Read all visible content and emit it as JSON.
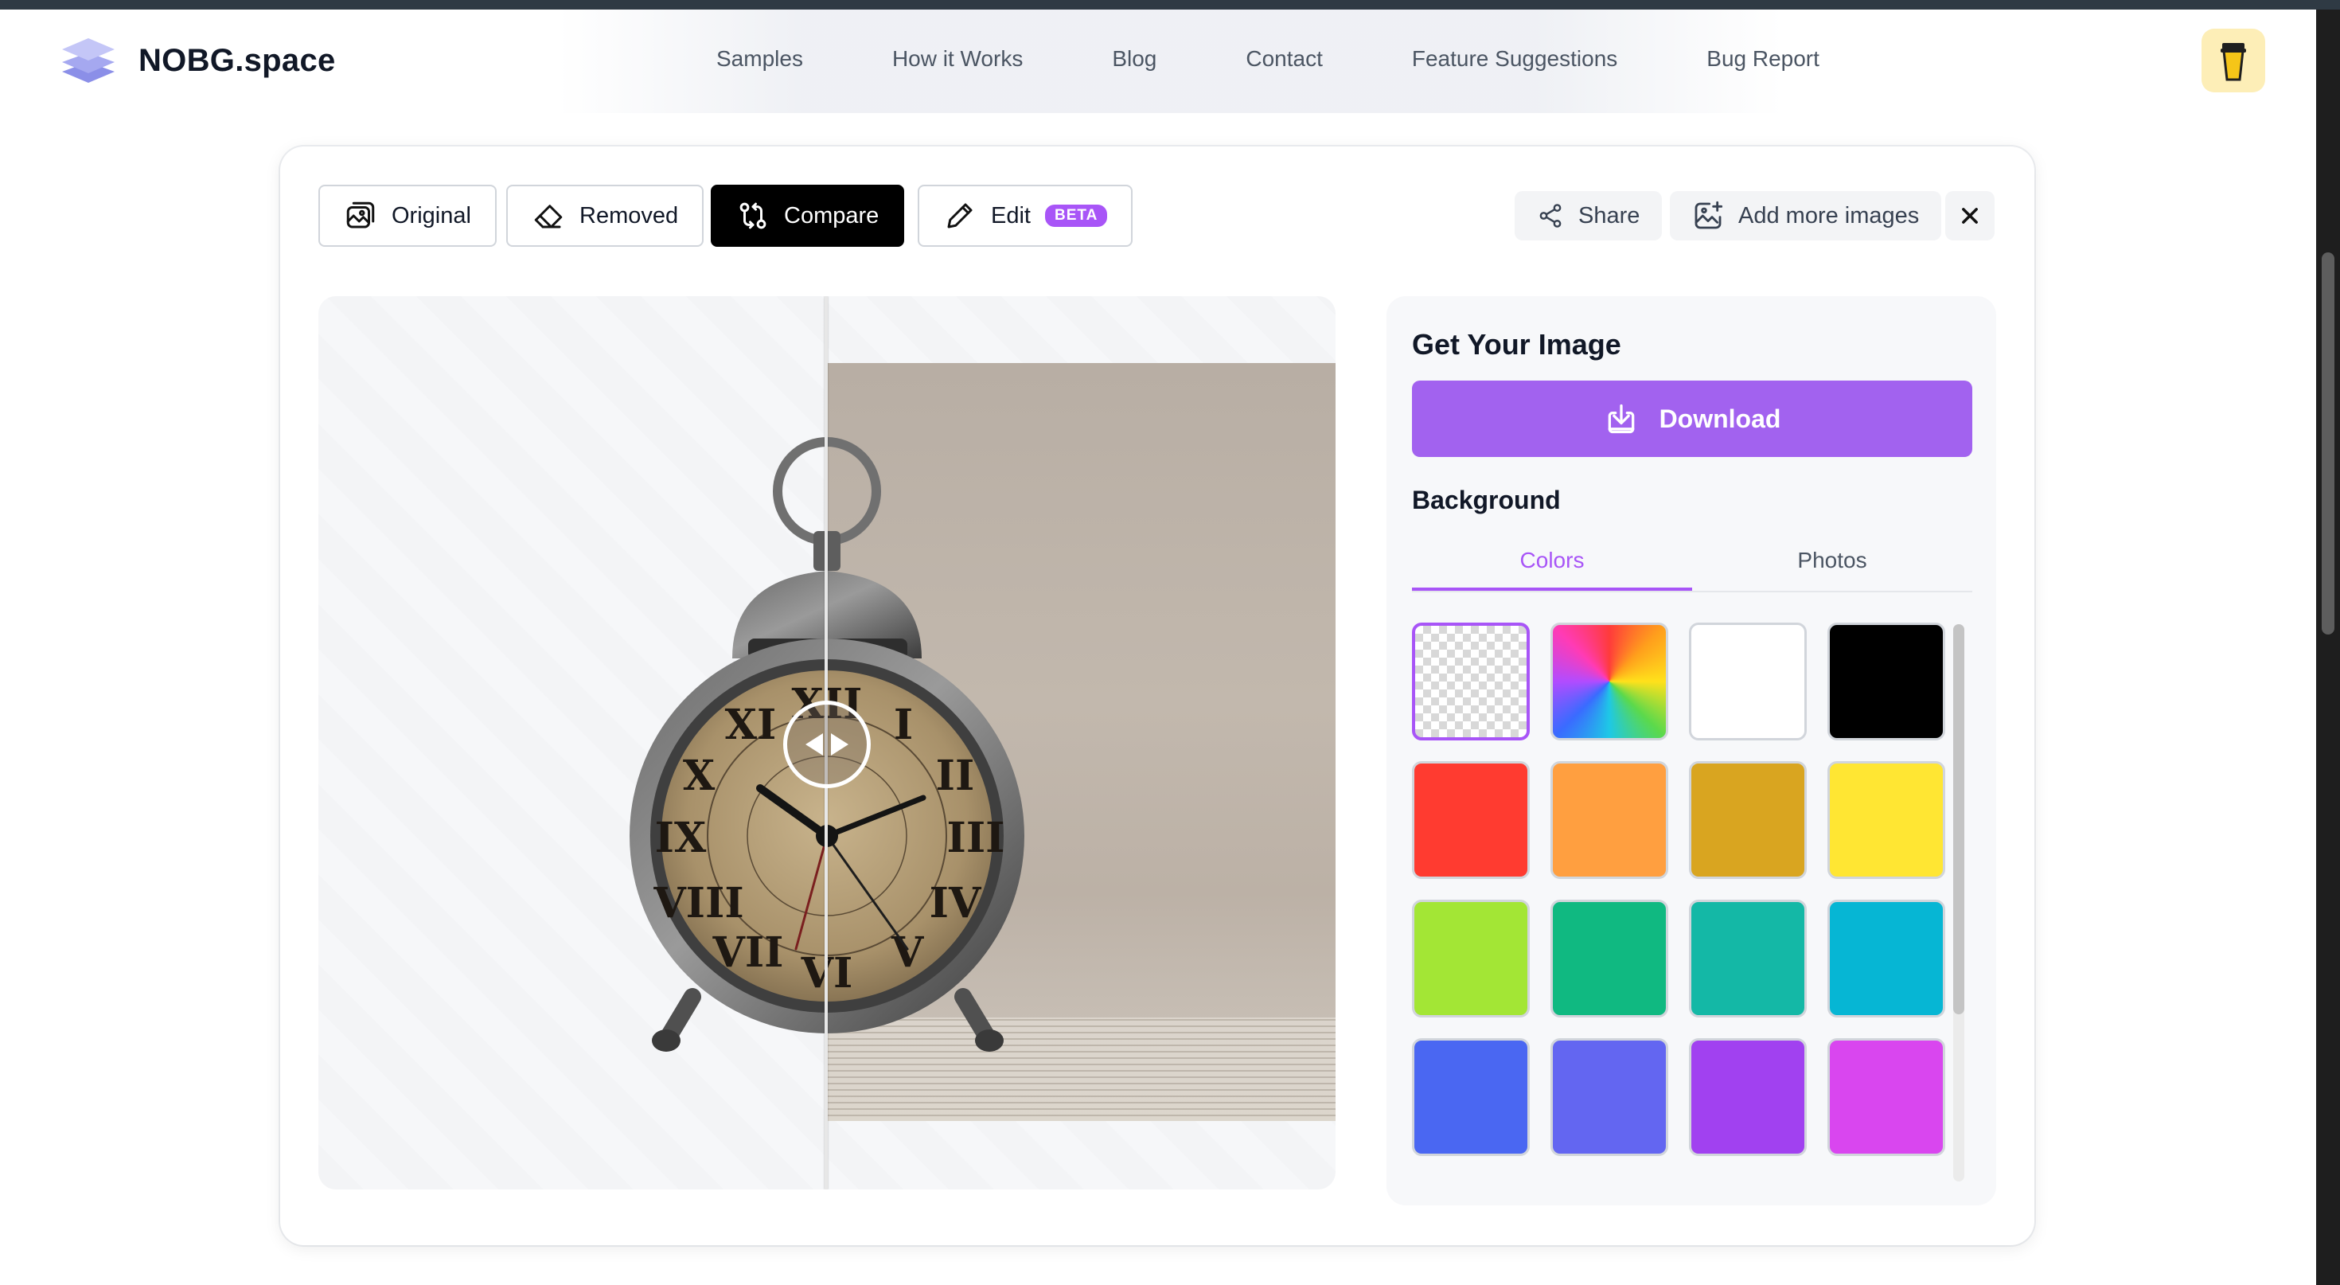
{
  "header": {
    "brand": "NOBG.space",
    "nav": [
      "Samples",
      "How it Works",
      "Blog",
      "Contact",
      "Feature Suggestions",
      "Bug Report"
    ]
  },
  "view_tabs": {
    "original": "Original",
    "removed": "Removed",
    "compare": "Compare",
    "edit": "Edit",
    "edit_badge": "BETA",
    "active": "Compare"
  },
  "toolbar": {
    "share": "Share",
    "add_more": "Add more images"
  },
  "panel": {
    "title": "Get Your Image",
    "download": "Download",
    "background_title": "Background",
    "tabs": [
      "Colors",
      "Photos"
    ],
    "active_tab": "Colors",
    "swatches": [
      "transparent",
      "rainbow",
      "#ffffff",
      "#000000",
      "#ff3b30",
      "#ff9f40",
      "#d9a520",
      "#ffe633",
      "#a3e635",
      "#10b981",
      "#14b8a6",
      "#06b6d4",
      "#4a67f2",
      "#6366f1",
      "#a141f0",
      "#d946ef"
    ],
    "selected_swatch": "transparent"
  },
  "colors": {
    "accent": "#a855f7",
    "download_bg": "#a262ef"
  }
}
